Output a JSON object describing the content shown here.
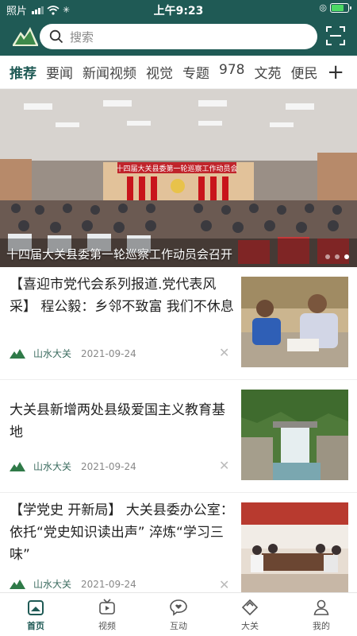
{
  "status": {
    "carrier": "照片",
    "time": "上午9:23"
  },
  "search": {
    "placeholder": "搜索"
  },
  "tabs": [
    "推荐",
    "要闻",
    "新闻视频",
    "视觉",
    "专题",
    "978",
    "文苑",
    "便民"
  ],
  "tabs_plus": "+",
  "banner": {
    "caption": "十四届大关县委第一轮巡察工作动员会召开",
    "slides": 3,
    "active_slide": 3
  },
  "news": [
    {
      "title": "【喜迎市党代会系列报道.党代表风采】 程公毅：乡邻不致富 我们不休息",
      "source": "山水大关",
      "date": "2021-09-24"
    },
    {
      "title": "大关县新增两处县级爱国主义教育基地",
      "source": "山水大关",
      "date": "2021-09-24"
    },
    {
      "title": "【学党史  开新局】 大关县委办公室：依托“党史知识读出声” 淬炼“学习三味”",
      "source": "山水大关",
      "date": "2021-09-24"
    }
  ],
  "bottom_nav": [
    {
      "label": "首页",
      "icon": "home-icon"
    },
    {
      "label": "视频",
      "icon": "tv-icon"
    },
    {
      "label": "互动",
      "icon": "chat-heart-icon"
    },
    {
      "label": "大关",
      "icon": "diamond-icon"
    },
    {
      "label": "我的",
      "icon": "person-icon"
    }
  ],
  "colors": {
    "brand": "#1f5a55",
    "accent_text": "#3a6b5e"
  }
}
